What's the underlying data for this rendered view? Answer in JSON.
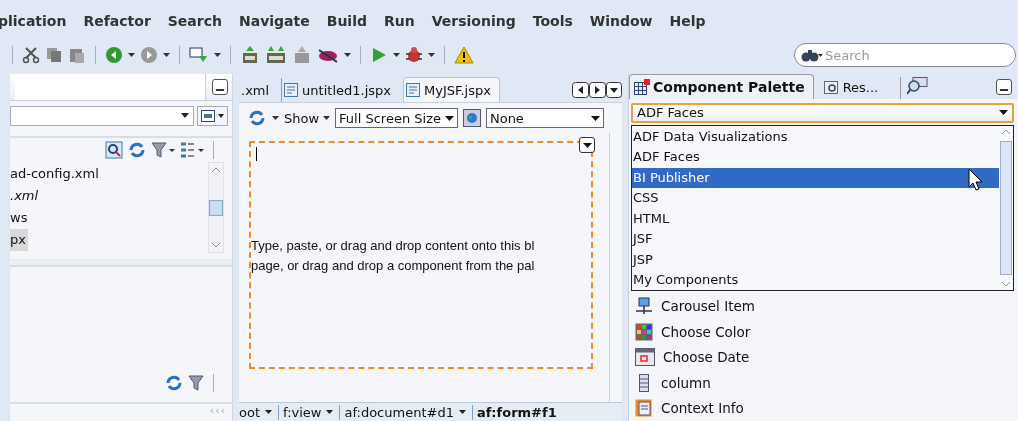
{
  "menu": [
    "plication",
    "Refactor",
    "Search",
    "Navigate",
    "Build",
    "Run",
    "Versioning",
    "Tools",
    "Window",
    "Help"
  ],
  "search": {
    "placeholder": "Search"
  },
  "left_panel": {
    "tree": [
      {
        "label": "ad-config.xml",
        "italic": false,
        "selected": false
      },
      {
        "label": ".xml",
        "italic": true,
        "selected": false
      },
      {
        "label": "ws",
        "italic": false,
        "selected": false
      },
      {
        "label": "px",
        "italic": false,
        "selected": true
      }
    ],
    "scroll_button": "‹‹‹"
  },
  "editor": {
    "tabs": [
      {
        "label": ".xml",
        "selected": false,
        "icon": false
      },
      {
        "label": "untitled1.jspx",
        "selected": false,
        "icon": true
      },
      {
        "label": "MyJSF.jspx",
        "selected": true,
        "icon": true
      }
    ],
    "show_label": "Show",
    "size_select": "Full Screen Size",
    "skin_select": "None",
    "hint_lines": [
      "Type, paste, or drag and drop content onto this bl",
      "page, or drag and drop a component from the pal"
    ],
    "breadcrumb": [
      {
        "label": "oot",
        "current": false
      },
      {
        "label": "f:view",
        "current": false
      },
      {
        "label": "af:document#d1",
        "current": false
      },
      {
        "label": "af:form#f1",
        "current": true
      }
    ]
  },
  "palette": {
    "tabs": [
      {
        "label": "Component Palette",
        "selected": true
      },
      {
        "label": "Res...",
        "selected": false
      }
    ],
    "library": "ADF Faces",
    "options": [
      {
        "label": "ADF Data Visualizations",
        "selected": false
      },
      {
        "label": "ADF Faces",
        "selected": false
      },
      {
        "label": "BI Publisher",
        "selected": true
      },
      {
        "label": "CSS",
        "selected": false
      },
      {
        "label": "HTML",
        "selected": false
      },
      {
        "label": "JSF",
        "selected": false
      },
      {
        "label": "JSP",
        "selected": false
      },
      {
        "label": "My Components",
        "selected": false
      }
    ],
    "components": [
      {
        "label": "Carousel Item",
        "kind": "carousel"
      },
      {
        "label": "Choose Color",
        "kind": "color"
      },
      {
        "label": "Choose Date",
        "kind": "date"
      },
      {
        "label": "column",
        "kind": "column"
      },
      {
        "label": "Context Info",
        "kind": "info"
      }
    ]
  }
}
